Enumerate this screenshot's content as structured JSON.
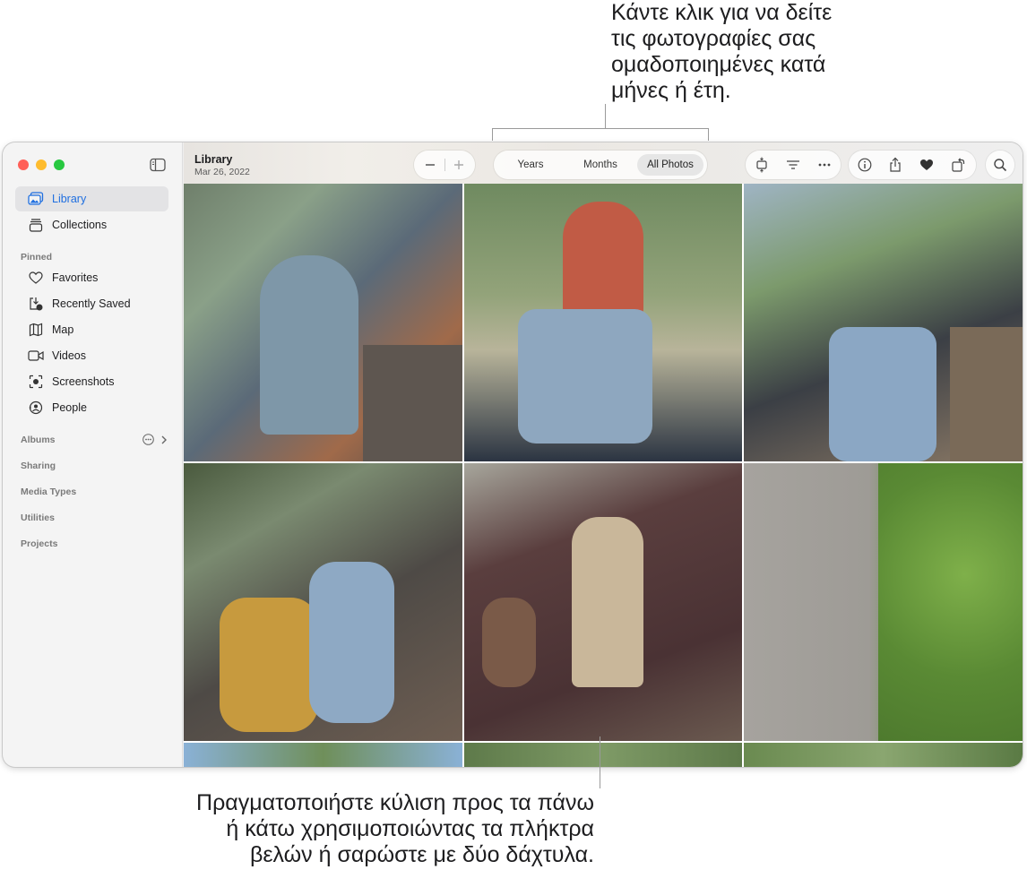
{
  "callouts": {
    "top": [
      "Κάντε κλικ για να δείτε",
      "τις φωτογραφίες σας",
      "ομαδοποιημένες κατά",
      "μήνες ή έτη."
    ],
    "bottom": [
      "Πραγματοποιήστε κύλιση προς τα πάνω",
      "ή κάτω χρησιμοποιώντας τα πλήκτρα",
      "βελών ή σαρώστε με δύο δάχτυλα."
    ]
  },
  "sidebar": {
    "top_items": [
      {
        "label": "Library",
        "icon": "photo-library-icon",
        "active": true
      },
      {
        "label": "Collections",
        "icon": "collections-icon"
      }
    ],
    "pinned_header": "Pinned",
    "pinned_items": [
      {
        "label": "Favorites",
        "icon": "heart-icon"
      },
      {
        "label": "Recently Saved",
        "icon": "recently-saved-icon"
      },
      {
        "label": "Map",
        "icon": "map-icon"
      },
      {
        "label": "Videos",
        "icon": "video-icon"
      },
      {
        "label": "Screenshots",
        "icon": "screenshot-icon"
      },
      {
        "label": "People",
        "icon": "people-icon"
      }
    ],
    "sections": [
      "Albums",
      "Sharing",
      "Media Types",
      "Utilities",
      "Projects"
    ]
  },
  "toolbar": {
    "title": "Library",
    "date": "Mar 26, 2022",
    "view_options": [
      "Years",
      "Months",
      "All Photos"
    ],
    "selected_view": "All Photos"
  },
  "colors": {
    "accent": "#1f6fe0",
    "close": "#ff5f57",
    "minimize": "#febc2e",
    "maximize": "#28c840"
  }
}
